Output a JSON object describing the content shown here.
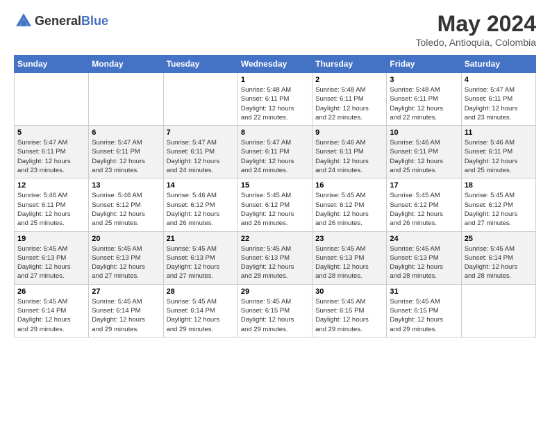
{
  "header": {
    "logo_general": "General",
    "logo_blue": "Blue",
    "month_year": "May 2024",
    "location": "Toledo, Antioquia, Colombia"
  },
  "days_of_week": [
    "Sunday",
    "Monday",
    "Tuesday",
    "Wednesday",
    "Thursday",
    "Friday",
    "Saturday"
  ],
  "weeks": [
    [
      {
        "day": "",
        "info": ""
      },
      {
        "day": "",
        "info": ""
      },
      {
        "day": "",
        "info": ""
      },
      {
        "day": "1",
        "info": "Sunrise: 5:48 AM\nSunset: 6:11 PM\nDaylight: 12 hours\nand 22 minutes."
      },
      {
        "day": "2",
        "info": "Sunrise: 5:48 AM\nSunset: 6:11 PM\nDaylight: 12 hours\nand 22 minutes."
      },
      {
        "day": "3",
        "info": "Sunrise: 5:48 AM\nSunset: 6:11 PM\nDaylight: 12 hours\nand 22 minutes."
      },
      {
        "day": "4",
        "info": "Sunrise: 5:47 AM\nSunset: 6:11 PM\nDaylight: 12 hours\nand 23 minutes."
      }
    ],
    [
      {
        "day": "5",
        "info": "Sunrise: 5:47 AM\nSunset: 6:11 PM\nDaylight: 12 hours\nand 23 minutes."
      },
      {
        "day": "6",
        "info": "Sunrise: 5:47 AM\nSunset: 6:11 PM\nDaylight: 12 hours\nand 23 minutes."
      },
      {
        "day": "7",
        "info": "Sunrise: 5:47 AM\nSunset: 6:11 PM\nDaylight: 12 hours\nand 24 minutes."
      },
      {
        "day": "8",
        "info": "Sunrise: 5:47 AM\nSunset: 6:11 PM\nDaylight: 12 hours\nand 24 minutes."
      },
      {
        "day": "9",
        "info": "Sunrise: 5:46 AM\nSunset: 6:11 PM\nDaylight: 12 hours\nand 24 minutes."
      },
      {
        "day": "10",
        "info": "Sunrise: 5:46 AM\nSunset: 6:11 PM\nDaylight: 12 hours\nand 25 minutes."
      },
      {
        "day": "11",
        "info": "Sunrise: 5:46 AM\nSunset: 6:11 PM\nDaylight: 12 hours\nand 25 minutes."
      }
    ],
    [
      {
        "day": "12",
        "info": "Sunrise: 5:46 AM\nSunset: 6:11 PM\nDaylight: 12 hours\nand 25 minutes."
      },
      {
        "day": "13",
        "info": "Sunrise: 5:46 AM\nSunset: 6:12 PM\nDaylight: 12 hours\nand 25 minutes."
      },
      {
        "day": "14",
        "info": "Sunrise: 5:46 AM\nSunset: 6:12 PM\nDaylight: 12 hours\nand 26 minutes."
      },
      {
        "day": "15",
        "info": "Sunrise: 5:45 AM\nSunset: 6:12 PM\nDaylight: 12 hours\nand 26 minutes."
      },
      {
        "day": "16",
        "info": "Sunrise: 5:45 AM\nSunset: 6:12 PM\nDaylight: 12 hours\nand 26 minutes."
      },
      {
        "day": "17",
        "info": "Sunrise: 5:45 AM\nSunset: 6:12 PM\nDaylight: 12 hours\nand 26 minutes."
      },
      {
        "day": "18",
        "info": "Sunrise: 5:45 AM\nSunset: 6:12 PM\nDaylight: 12 hours\nand 27 minutes."
      }
    ],
    [
      {
        "day": "19",
        "info": "Sunrise: 5:45 AM\nSunset: 6:13 PM\nDaylight: 12 hours\nand 27 minutes."
      },
      {
        "day": "20",
        "info": "Sunrise: 5:45 AM\nSunset: 6:13 PM\nDaylight: 12 hours\nand 27 minutes."
      },
      {
        "day": "21",
        "info": "Sunrise: 5:45 AM\nSunset: 6:13 PM\nDaylight: 12 hours\nand 27 minutes."
      },
      {
        "day": "22",
        "info": "Sunrise: 5:45 AM\nSunset: 6:13 PM\nDaylight: 12 hours\nand 28 minutes."
      },
      {
        "day": "23",
        "info": "Sunrise: 5:45 AM\nSunset: 6:13 PM\nDaylight: 12 hours\nand 28 minutes."
      },
      {
        "day": "24",
        "info": "Sunrise: 5:45 AM\nSunset: 6:13 PM\nDaylight: 12 hours\nand 28 minutes."
      },
      {
        "day": "25",
        "info": "Sunrise: 5:45 AM\nSunset: 6:14 PM\nDaylight: 12 hours\nand 28 minutes."
      }
    ],
    [
      {
        "day": "26",
        "info": "Sunrise: 5:45 AM\nSunset: 6:14 PM\nDaylight: 12 hours\nand 29 minutes."
      },
      {
        "day": "27",
        "info": "Sunrise: 5:45 AM\nSunset: 6:14 PM\nDaylight: 12 hours\nand 29 minutes."
      },
      {
        "day": "28",
        "info": "Sunrise: 5:45 AM\nSunset: 6:14 PM\nDaylight: 12 hours\nand 29 minutes."
      },
      {
        "day": "29",
        "info": "Sunrise: 5:45 AM\nSunset: 6:15 PM\nDaylight: 12 hours\nand 29 minutes."
      },
      {
        "day": "30",
        "info": "Sunrise: 5:45 AM\nSunset: 6:15 PM\nDaylight: 12 hours\nand 29 minutes."
      },
      {
        "day": "31",
        "info": "Sunrise: 5:45 AM\nSunset: 6:15 PM\nDaylight: 12 hours\nand 29 minutes."
      },
      {
        "day": "",
        "info": ""
      }
    ]
  ]
}
